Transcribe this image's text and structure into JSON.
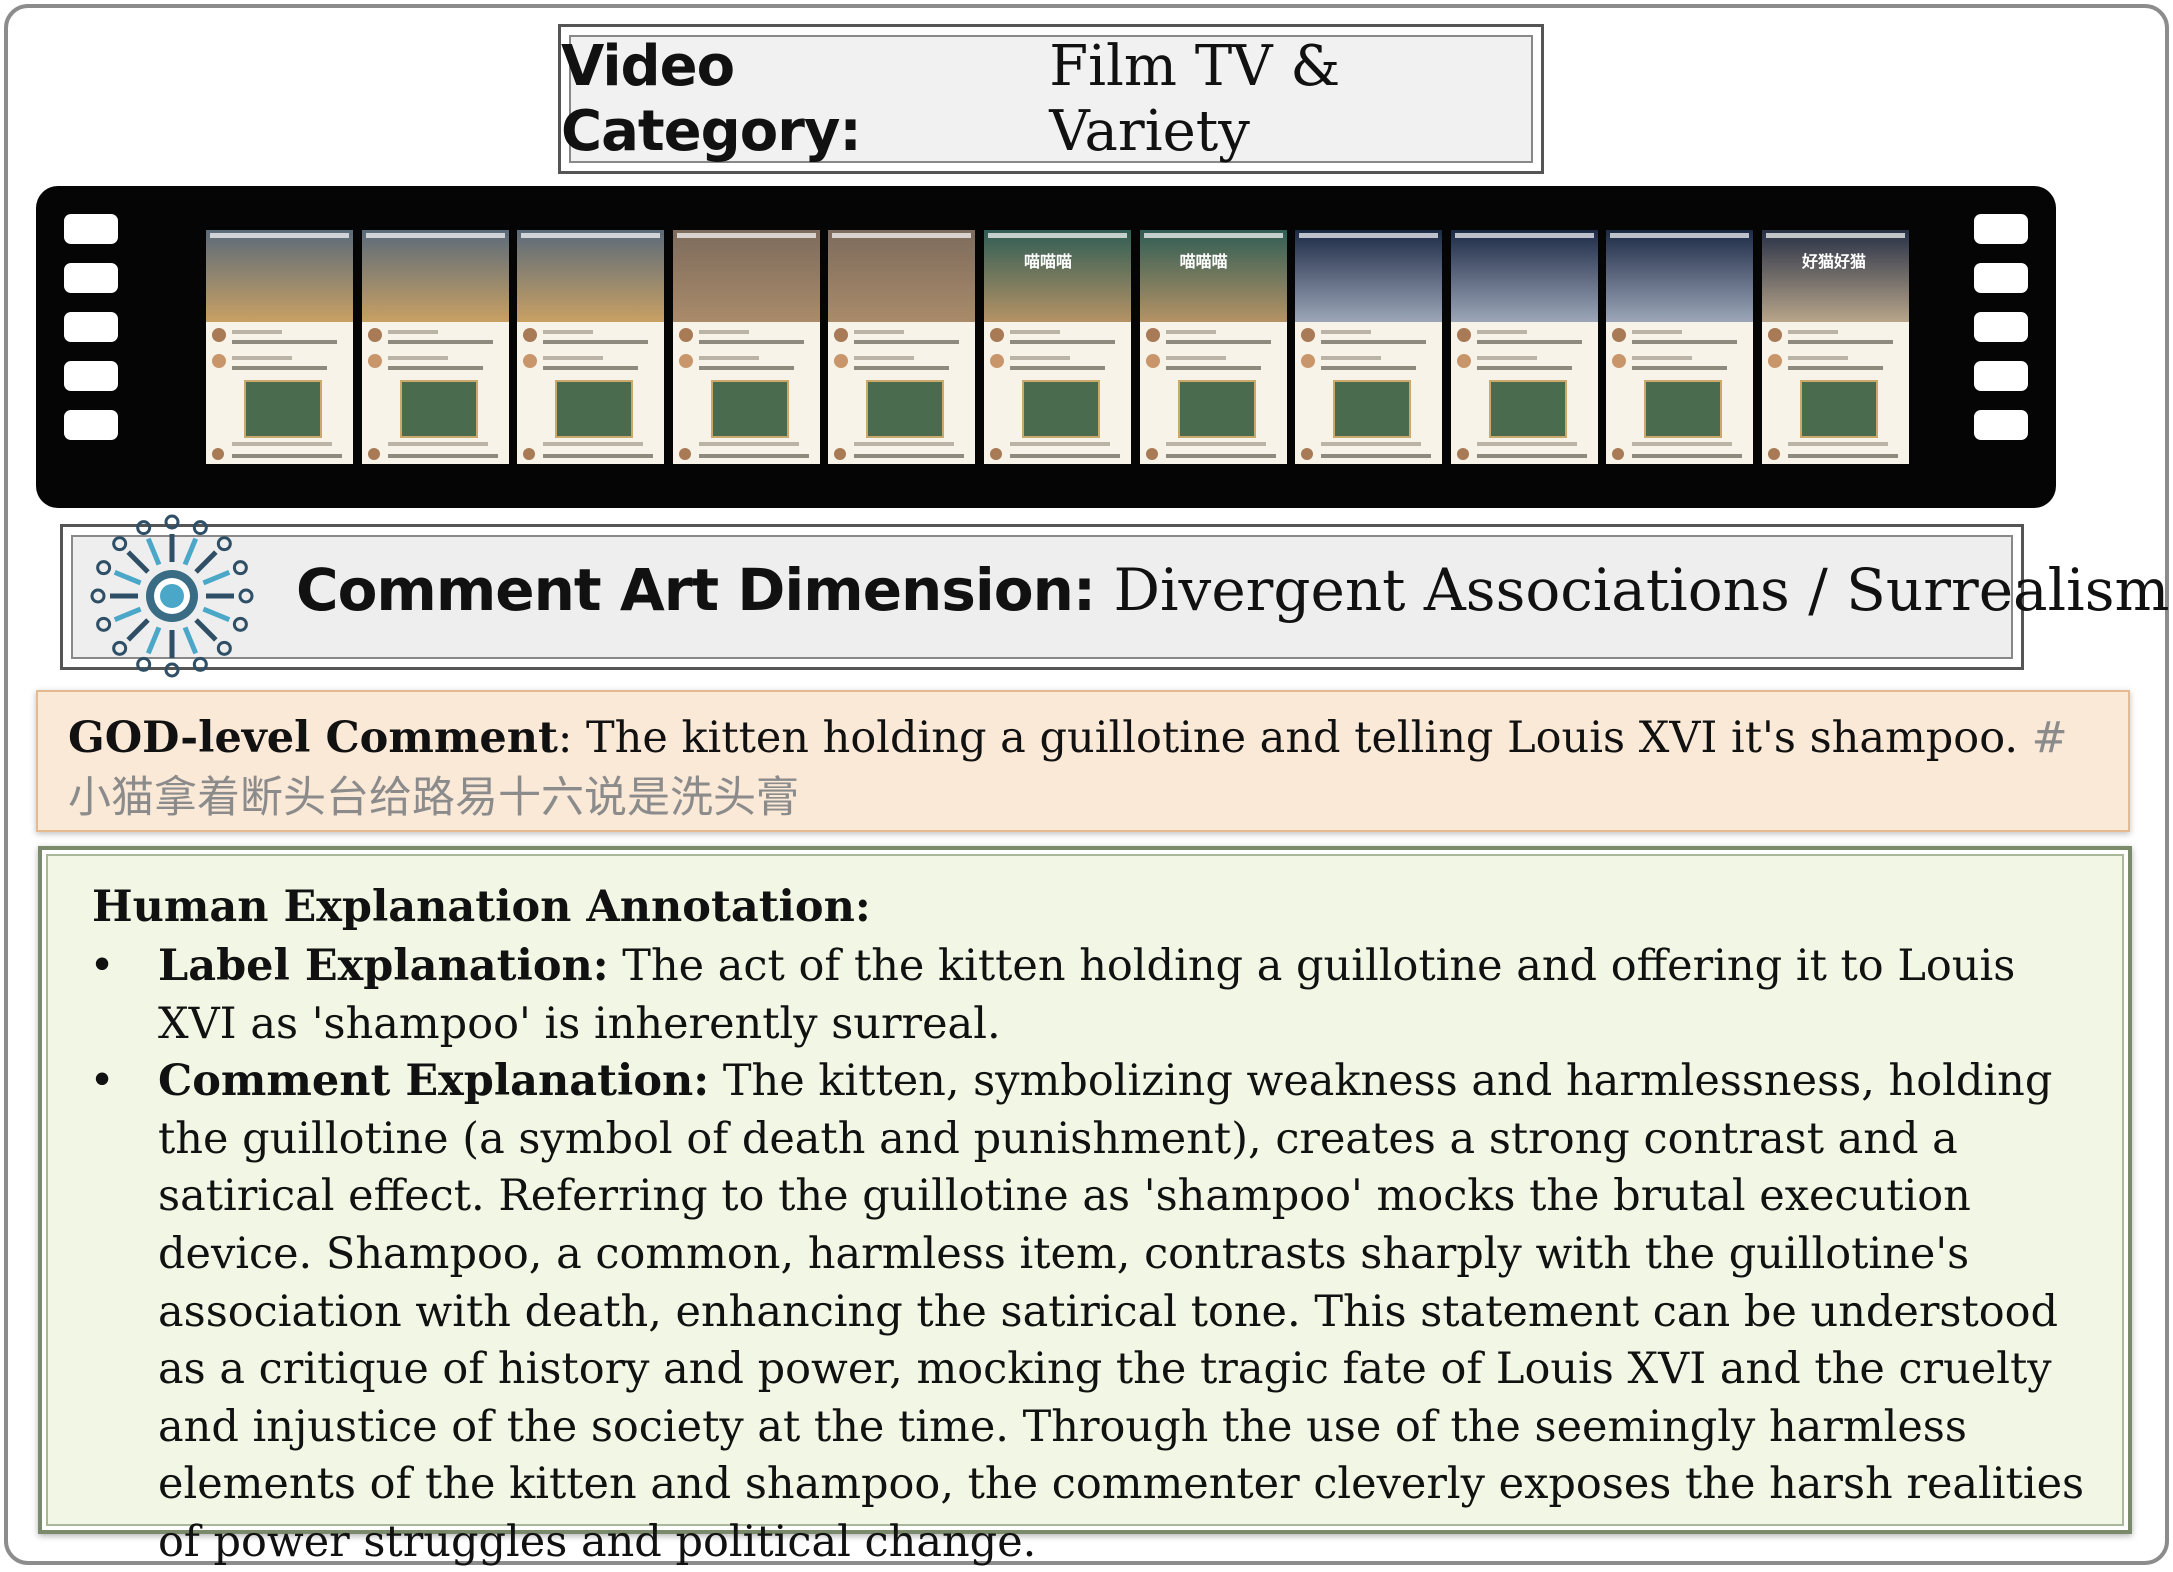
{
  "category": {
    "label": "Video Category:",
    "value": "Film TV & Variety"
  },
  "film_strip": {
    "frames": [
      {
        "scene": "#5a6a7a",
        "accent": "#c8a063"
      },
      {
        "scene": "#5a6a7a",
        "accent": "#c8a063"
      },
      {
        "scene": "#5a6a7a",
        "accent": "#c8a063"
      },
      {
        "scene": "#7d6b5d",
        "accent": "#a98b6a"
      },
      {
        "scene": "#7d6b5d",
        "accent": "#a98b6a"
      },
      {
        "scene": "#2f5d55",
        "accent": "#b59265",
        "caption": "喵喵喵"
      },
      {
        "scene": "#2f5d55",
        "accent": "#b59265",
        "caption": "喵喵喵"
      },
      {
        "scene": "#1d2a45",
        "accent": "#9ca6b8"
      },
      {
        "scene": "#1d2a45",
        "accent": "#9ca6b8"
      },
      {
        "scene": "#1d2a45",
        "accent": "#9ca6b8"
      },
      {
        "scene": "#273046",
        "accent": "#b8a58a",
        "caption": "好猫好猫"
      }
    ]
  },
  "art_dimension": {
    "label": "Comment Art Dimension:",
    "value": "Divergent Associations / Surrealism",
    "icon": "hub-gear-icon"
  },
  "god_comment": {
    "label": "GOD-level Comment",
    "text": ": The kitten holding a guillotine and telling Louis XVI it's shampoo. ",
    "hashtag": "#小猫拿着断头台给路易十六说是洗头膏"
  },
  "human_explanation": {
    "title": "Human Explanation Annotation:",
    "items": [
      {
        "label": "Label Explanation:",
        "text": " The act of the kitten holding a guillotine and offering it to Louis XVI as 'shampoo' is inherently surreal."
      },
      {
        "label": "Comment Explanation:",
        "text": " The kitten, symbolizing weakness and harmlessness, holding the guillotine (a symbol of death and punishment), creates a strong contrast and a satirical effect. Referring to the guillotine as 'shampoo' mocks the brutal execution device. Shampoo, a common, harmless item, contrasts sharply with the guillotine's association with death, enhancing the satirical tone. This statement can be understood as a critique of history and power, mocking the tragic fate of Louis XVI and the cruelty and injustice of the society at the time. Through the use of the seemingly harmless elements of the kitten and shampoo, the commenter cleverly exposes the harsh realities of power struggles and political change."
      }
    ]
  }
}
